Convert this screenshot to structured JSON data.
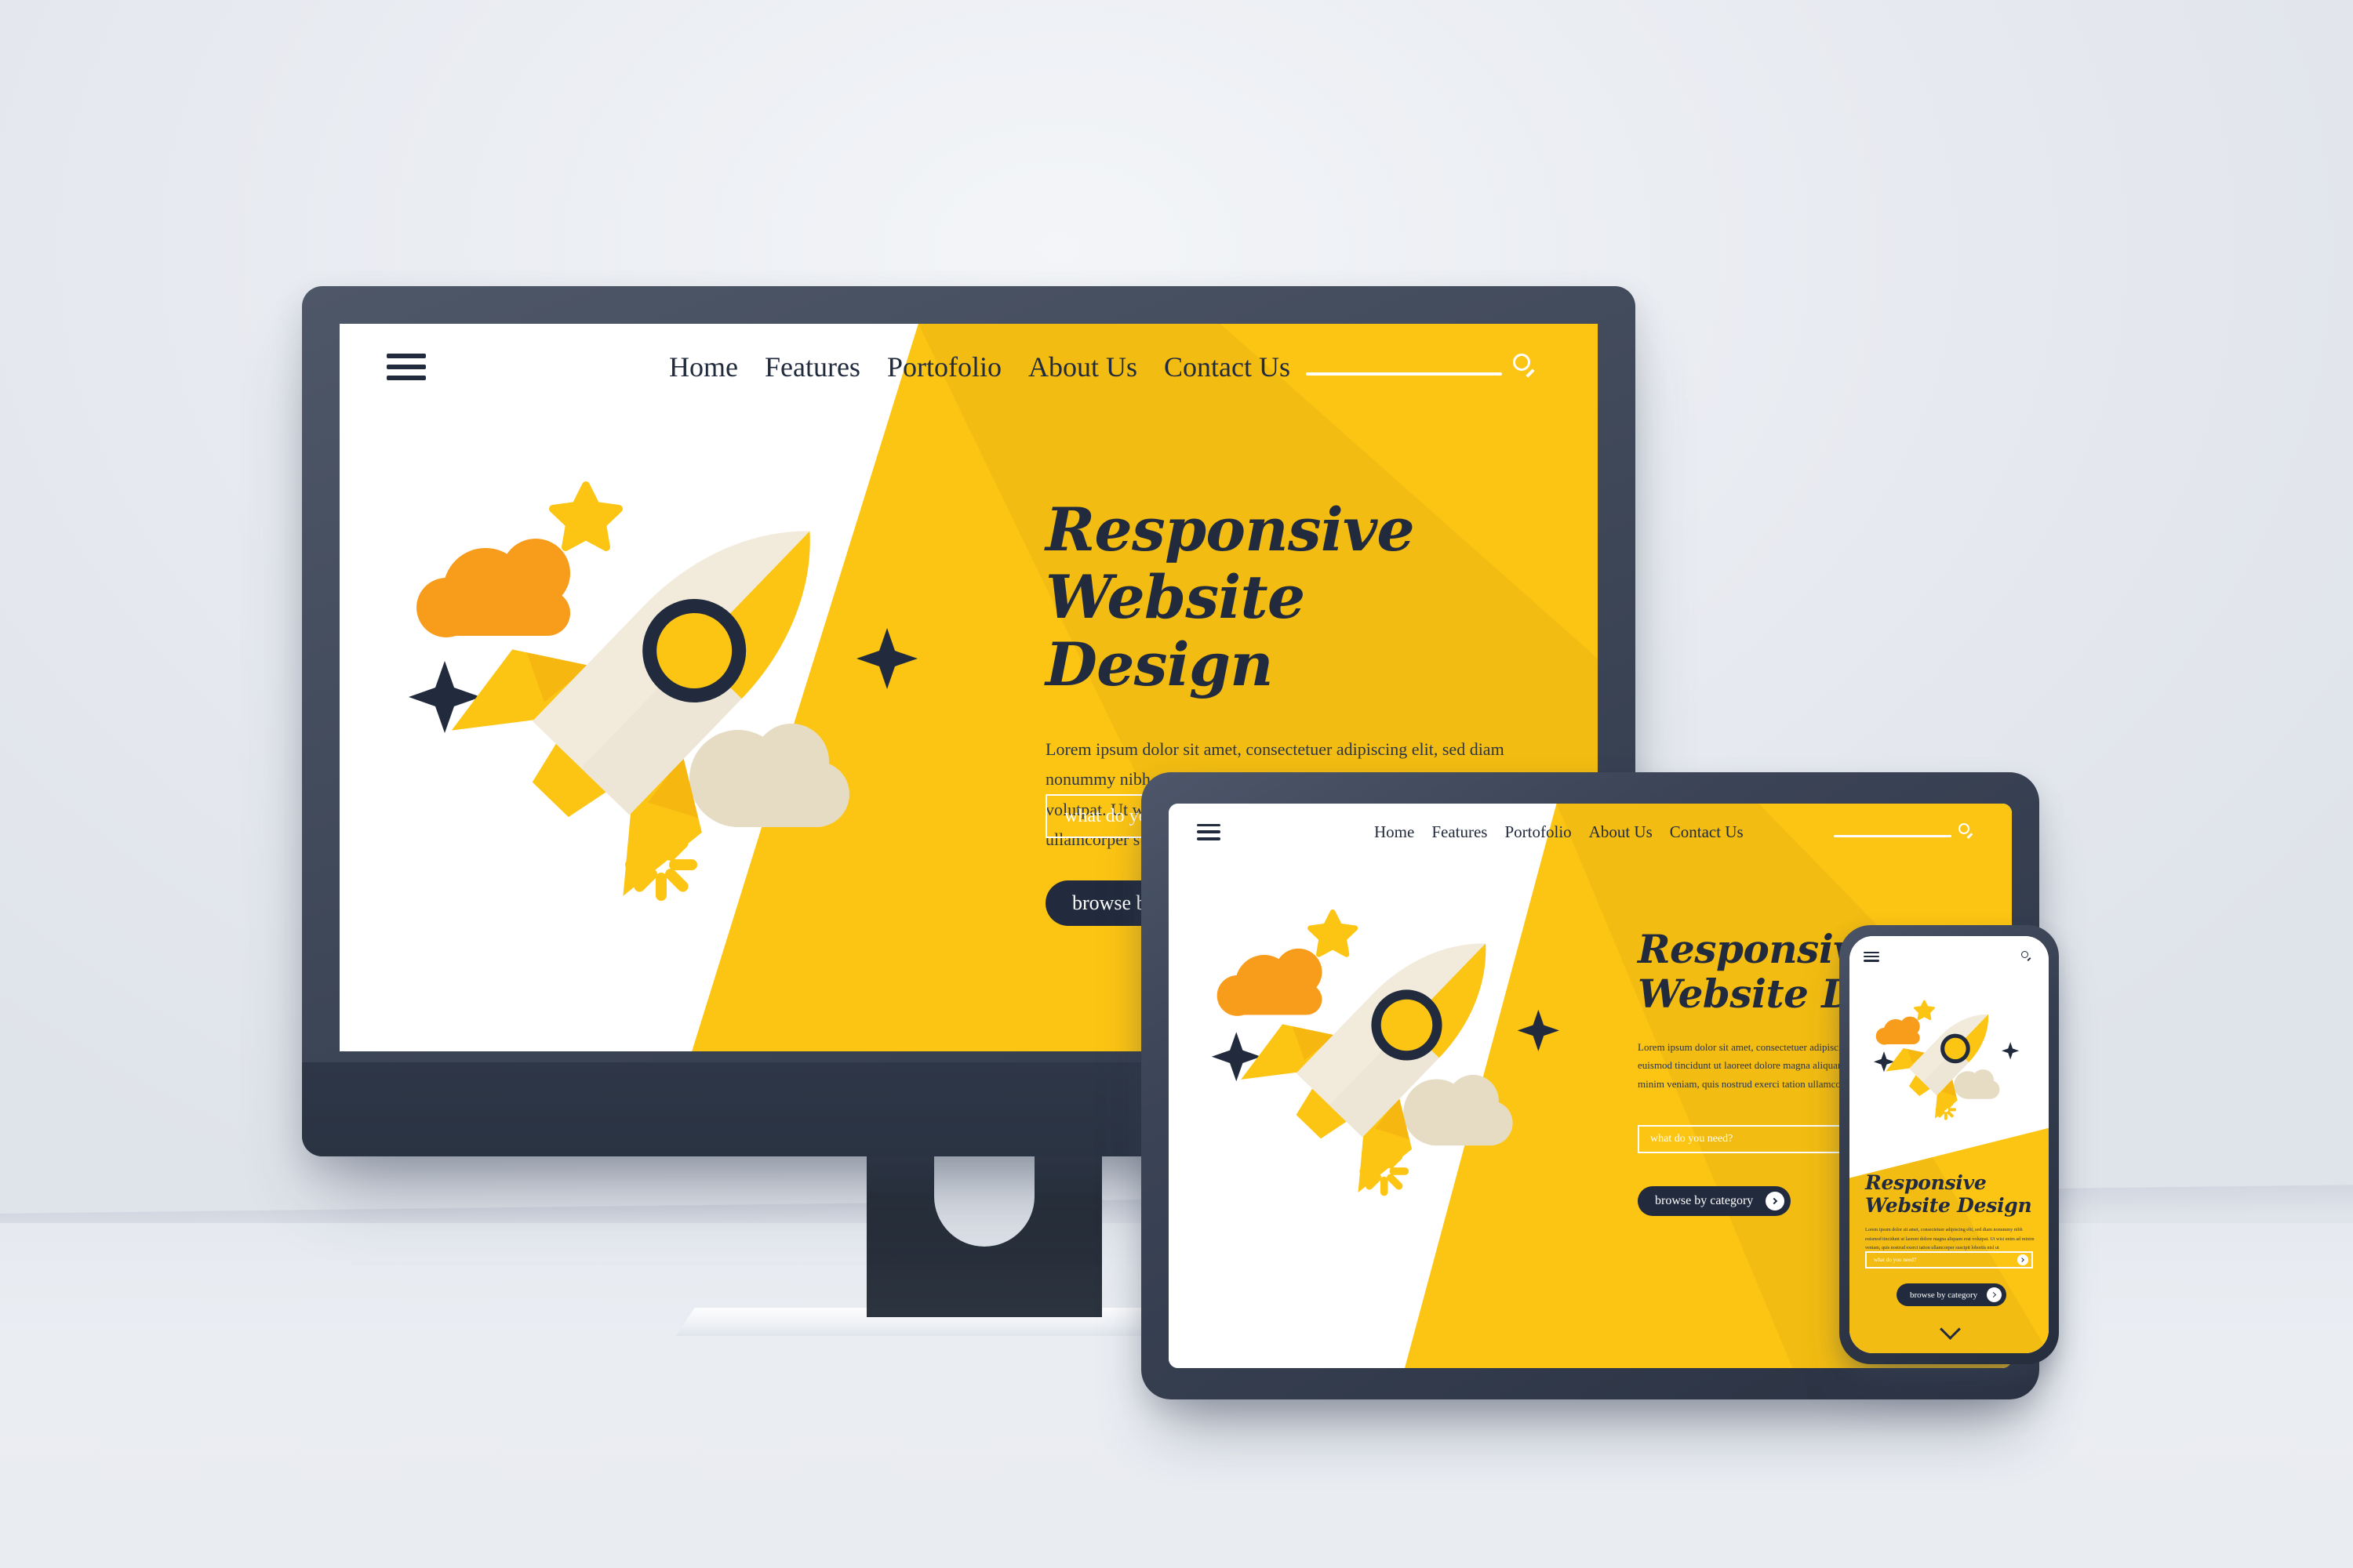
{
  "brand": {
    "yellow": "#FDC513",
    "yellow_dark": "#F0A81E",
    "navy": "#222B3D",
    "cream": "#F2EBDC",
    "beige": "#E6DCC4",
    "orange": "#F89C1C",
    "bezel_gray": "#454E60",
    "background": "#E7EAF0"
  },
  "site": {
    "nav": {
      "menu_icon": "hamburger-menu-icon",
      "links": [
        {
          "label": "Home"
        },
        {
          "label": "Features"
        },
        {
          "label": "Portofolio"
        },
        {
          "label": "About Us"
        },
        {
          "label": "Contact Us"
        }
      ],
      "search_icon": "search-icon",
      "search_value": ""
    },
    "hero": {
      "title_line1": "Responsive",
      "title_line2": "Website Design",
      "body": "Lorem ipsum dolor sit amet, consectetuer adipiscing elit, sed diam nonummy nibh euismod tincidunt ut laoreet dolore magna aliquam erat volutpat. Ut wisi enim ad minim veniam, quis nostrud exerci tation ullamcorper suscipit lobortis nisl ut"
    },
    "search_field": {
      "placeholder": "what do you need?",
      "value": "",
      "submit_icon": "chevron-right-icon"
    },
    "cta": {
      "label": "browse by category",
      "icon": "chevron-right-icon"
    },
    "scroll_hint_icon": "chevron-down-icon",
    "illustration": {
      "name": "rocket-illustration",
      "elements": [
        "rocket",
        "orange-cloud",
        "beige-cloud",
        "yellow-star",
        "navy-sparkle",
        "yellow-burst",
        "porthole"
      ]
    }
  },
  "devices": [
    {
      "name": "desktop-monitor"
    },
    {
      "name": "tablet"
    },
    {
      "name": "smartphone"
    }
  ]
}
